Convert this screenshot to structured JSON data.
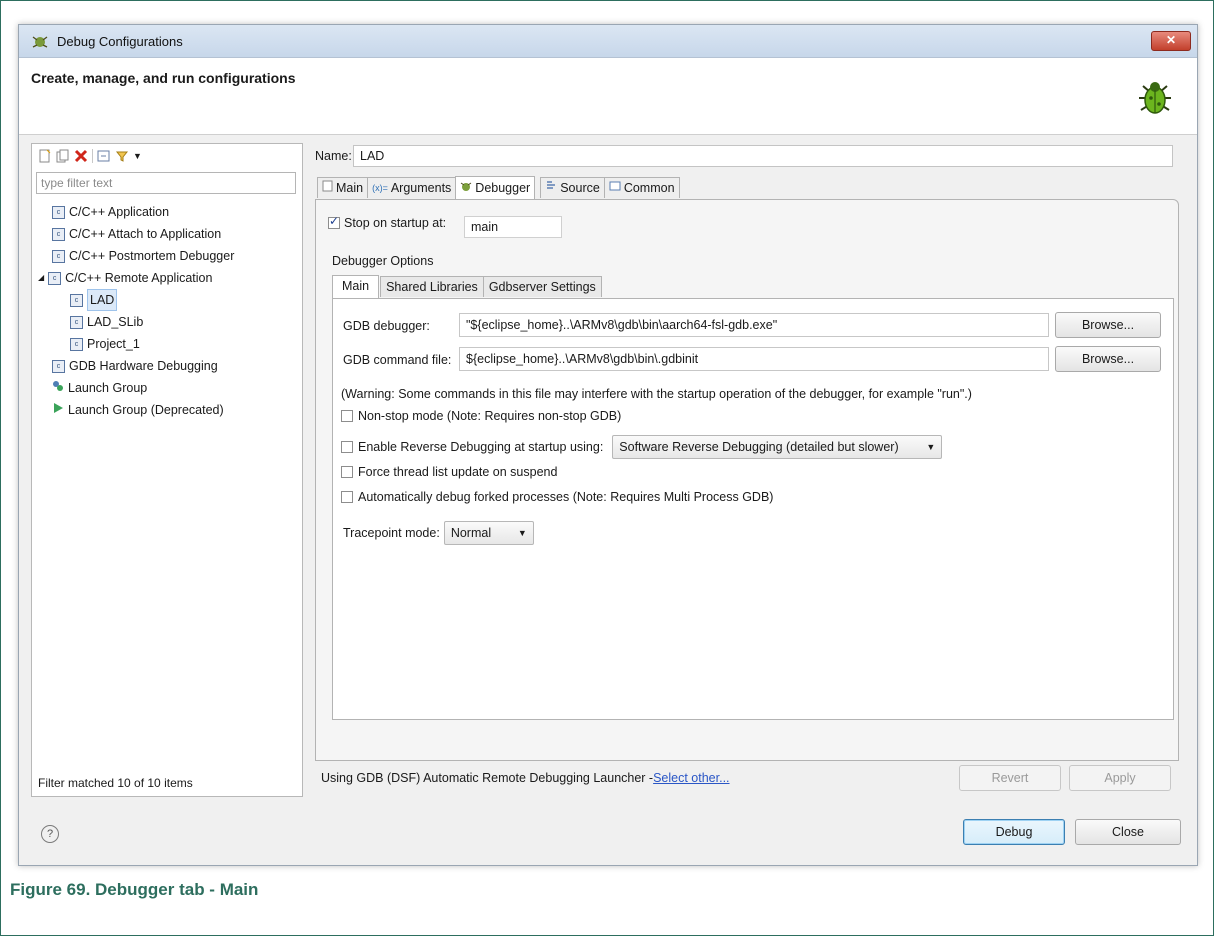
{
  "window": {
    "title": "Debug Configurations",
    "header_title": "Create, manage, and run configurations"
  },
  "left": {
    "filter_placeholder": "type filter text",
    "tree": [
      {
        "label": "C/C++ Application",
        "icon": "c-config-icon"
      },
      {
        "label": "C/C++ Attach to Application",
        "icon": "c-config-icon"
      },
      {
        "label": "C/C++ Postmortem Debugger",
        "icon": "c-config-icon"
      },
      {
        "label": "C/C++ Remote Application",
        "icon": "c-config-icon",
        "expanded": true
      },
      {
        "label": "LAD",
        "icon": "c-config-icon",
        "selected": true
      },
      {
        "label": "LAD_SLib",
        "icon": "c-config-icon"
      },
      {
        "label": "Project_1",
        "icon": "c-config-icon"
      },
      {
        "label": "GDB Hardware Debugging",
        "icon": "c-config-icon"
      },
      {
        "label": "Launch Group",
        "icon": "launch-group-icon"
      },
      {
        "label": "Launch Group (Deprecated)",
        "icon": "run-icon"
      }
    ],
    "footer": "Filter matched 10 of 10 items"
  },
  "config": {
    "name_label": "Name:",
    "name_value": "LAD",
    "tabs": [
      "Main",
      "Arguments",
      "Debugger",
      "Source",
      "Common"
    ],
    "active_tab": "Debugger",
    "stop_label": "Stop on startup at:",
    "stop_value": "main",
    "debugger_options_label": "Debugger Options",
    "inner_tabs": [
      "Main",
      "Shared Libraries",
      "Gdbserver Settings"
    ],
    "gdb_debugger_label": "GDB debugger:",
    "gdb_debugger_value": "\"${eclipse_home}..\\ARMv8\\gdb\\bin\\aarch64-fsl-gdb.exe\"",
    "gdb_command_label": "GDB command file:",
    "gdb_command_value": "${eclipse_home}..\\ARMv8\\gdb\\bin\\.gdbinit",
    "browse_label": "Browse...",
    "warning": "(Warning: Some commands in this file may interfere with the startup operation of the debugger, for example \"run\".)",
    "nonstop_label": "Non-stop mode (Note: Requires non-stop GDB)",
    "reverse_label": "Enable Reverse Debugging at startup using:",
    "reverse_option": "Software Reverse Debugging (detailed but slower)",
    "force_label": "Force thread list update on suspend",
    "forked_label": "Automatically debug forked processes (Note: Requires Multi Process GDB)",
    "tracepoint_label": "Tracepoint mode:",
    "tracepoint_value": "Normal",
    "launcher_text": "Using GDB (DSF) Automatic Remote Debugging Launcher - ",
    "select_other": "Select other...",
    "revert_label": "Revert",
    "apply_label": "Apply"
  },
  "footer": {
    "debug_label": "Debug",
    "close_label": "Close",
    "help_symbol": "?"
  },
  "caption": "Figure 69. Debugger tab - Main",
  "colors": {
    "caption": "#2d6e5e",
    "selection": "#dbe9f8",
    "link": "#2a56c6"
  }
}
